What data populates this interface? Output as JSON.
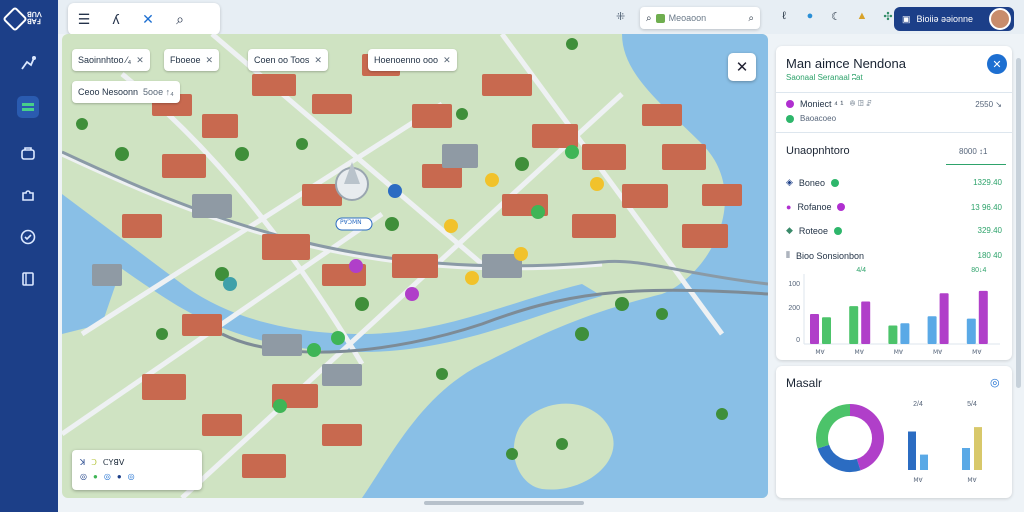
{
  "rail": {
    "logo_text_1": "ꓭꓵꓥ",
    "logo_text_2": "ꓭꓯꓞ",
    "items": [
      {
        "icon": "route-icon"
      },
      {
        "icon": "layers-icon"
      },
      {
        "icon": "bag-icon"
      },
      {
        "icon": "puzzle-icon"
      },
      {
        "icon": "chart-check-icon"
      },
      {
        "icon": "book-icon"
      }
    ]
  },
  "topbar": {
    "menu_glyph": "☰",
    "back_glyph": "ʎ",
    "forward_glyph": "(",
    "direction_glyph": "✕",
    "search_glyph": "⌕",
    "extra_glyph": "⁜",
    "search_placeholder": "Meoaoon",
    "icons": [
      {
        "name": "clip-icon",
        "glyph": "ℓ"
      },
      {
        "name": "circle-icon",
        "glyph": "●"
      },
      {
        "name": "moon-icon",
        "glyph": "☾"
      },
      {
        "name": "warning-icon",
        "glyph": "▲"
      },
      {
        "name": "tools-icon",
        "glyph": "✣"
      }
    ],
    "user_label": "Bioiiə əəionne"
  },
  "map": {
    "chips": [
      {
        "label": "Saoinnhtoo ⁄₄",
        "x": "✕"
      },
      {
        "label": "Fboeoe",
        "x": "✕"
      },
      {
        "label": "Coen oo Toos",
        "x": "✕"
      },
      {
        "label": "Hoenoenno ooo",
        "x": "✕"
      },
      {
        "label": "Ceoo Nesoonn",
        "x": "5ooe ↑₄"
      }
    ],
    "close_glyph": "✕",
    "legend": {
      "title": "ꓚꓬꓭꓦ",
      "row1": [
        "ꓘ",
        "ꓛ"
      ],
      "row2": [
        "◎",
        "●",
        "◎",
        "●",
        "◎"
      ]
    },
    "labels": [
      {
        "text": "ꓑꓯꓛꓟꓠ"
      }
    ]
  },
  "panel": {
    "title": "Man aimce Nendona",
    "subtitle": "Saonaal Seranaal ʭat",
    "close_glyph": "✕",
    "item1": {
      "label": "Moniect ⁴ ¹",
      "meta": "ꔮ ꖸ ꗕ",
      "value": "2550 ↘",
      "status": "Baoacoeo"
    },
    "section_title": "Unaopnhtoro",
    "section_value": "8000 ↕1",
    "rows": [
      {
        "label": "Boneo",
        "value": "1329.40",
        "color": "#2eb66b"
      },
      {
        "label": "Rofanoe",
        "value": "13 96.40",
        "color": "#b02fd0"
      },
      {
        "label": "Roteoe",
        "value": "329.40",
        "color": "#2eb66b"
      }
    ],
    "chart_row": {
      "label": "Bioo Sonsionbon",
      "value": "180 40"
    }
  },
  "chart_data": [
    {
      "type": "bar",
      "categories": [
        "",
        "",
        "",
        "",
        ""
      ],
      "series": [
        {
          "values": [
            65,
            82,
            40,
            60,
            55
          ]
        },
        {
          "values": [
            58,
            92,
            45,
            110,
            115
          ]
        }
      ],
      "yticks": [
        "100",
        "200",
        "0"
      ],
      "top_labels": [
        "",
        "4/4",
        "",
        "",
        "80↓4"
      ],
      "ylim": [
        0,
        130
      ]
    },
    {
      "type": "pie",
      "title": "Masalr",
      "values": [
        45,
        25,
        30
      ],
      "bar_labels": [
        "2/4",
        "5/4"
      ],
      "bars": [
        {
          "values": [
            70,
            28
          ]
        },
        {
          "values": [
            40,
            78
          ]
        }
      ]
    }
  ]
}
